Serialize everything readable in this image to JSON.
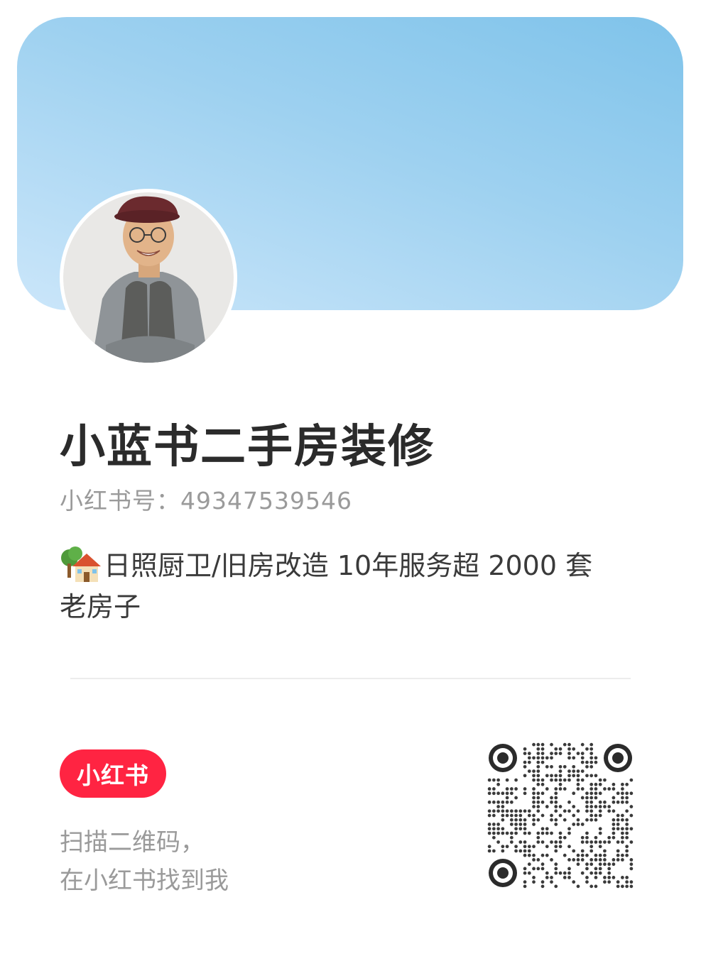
{
  "profile": {
    "nickname": "小蓝书二手房装修",
    "red_id": "小红书号：49347539546",
    "bio_line1": "日照厨卫/旧房改造 10年服务超 2000 套",
    "bio_line2": "老房子",
    "bio_emoji": "house-with-garden-icon"
  },
  "footer": {
    "logo_text": "小红书",
    "scan_line1": "扫描二维码，",
    "scan_line2": "在小红书找到我"
  },
  "colors": {
    "brand_red": "#ff2442",
    "banner_blue": "#9ed1f0"
  }
}
